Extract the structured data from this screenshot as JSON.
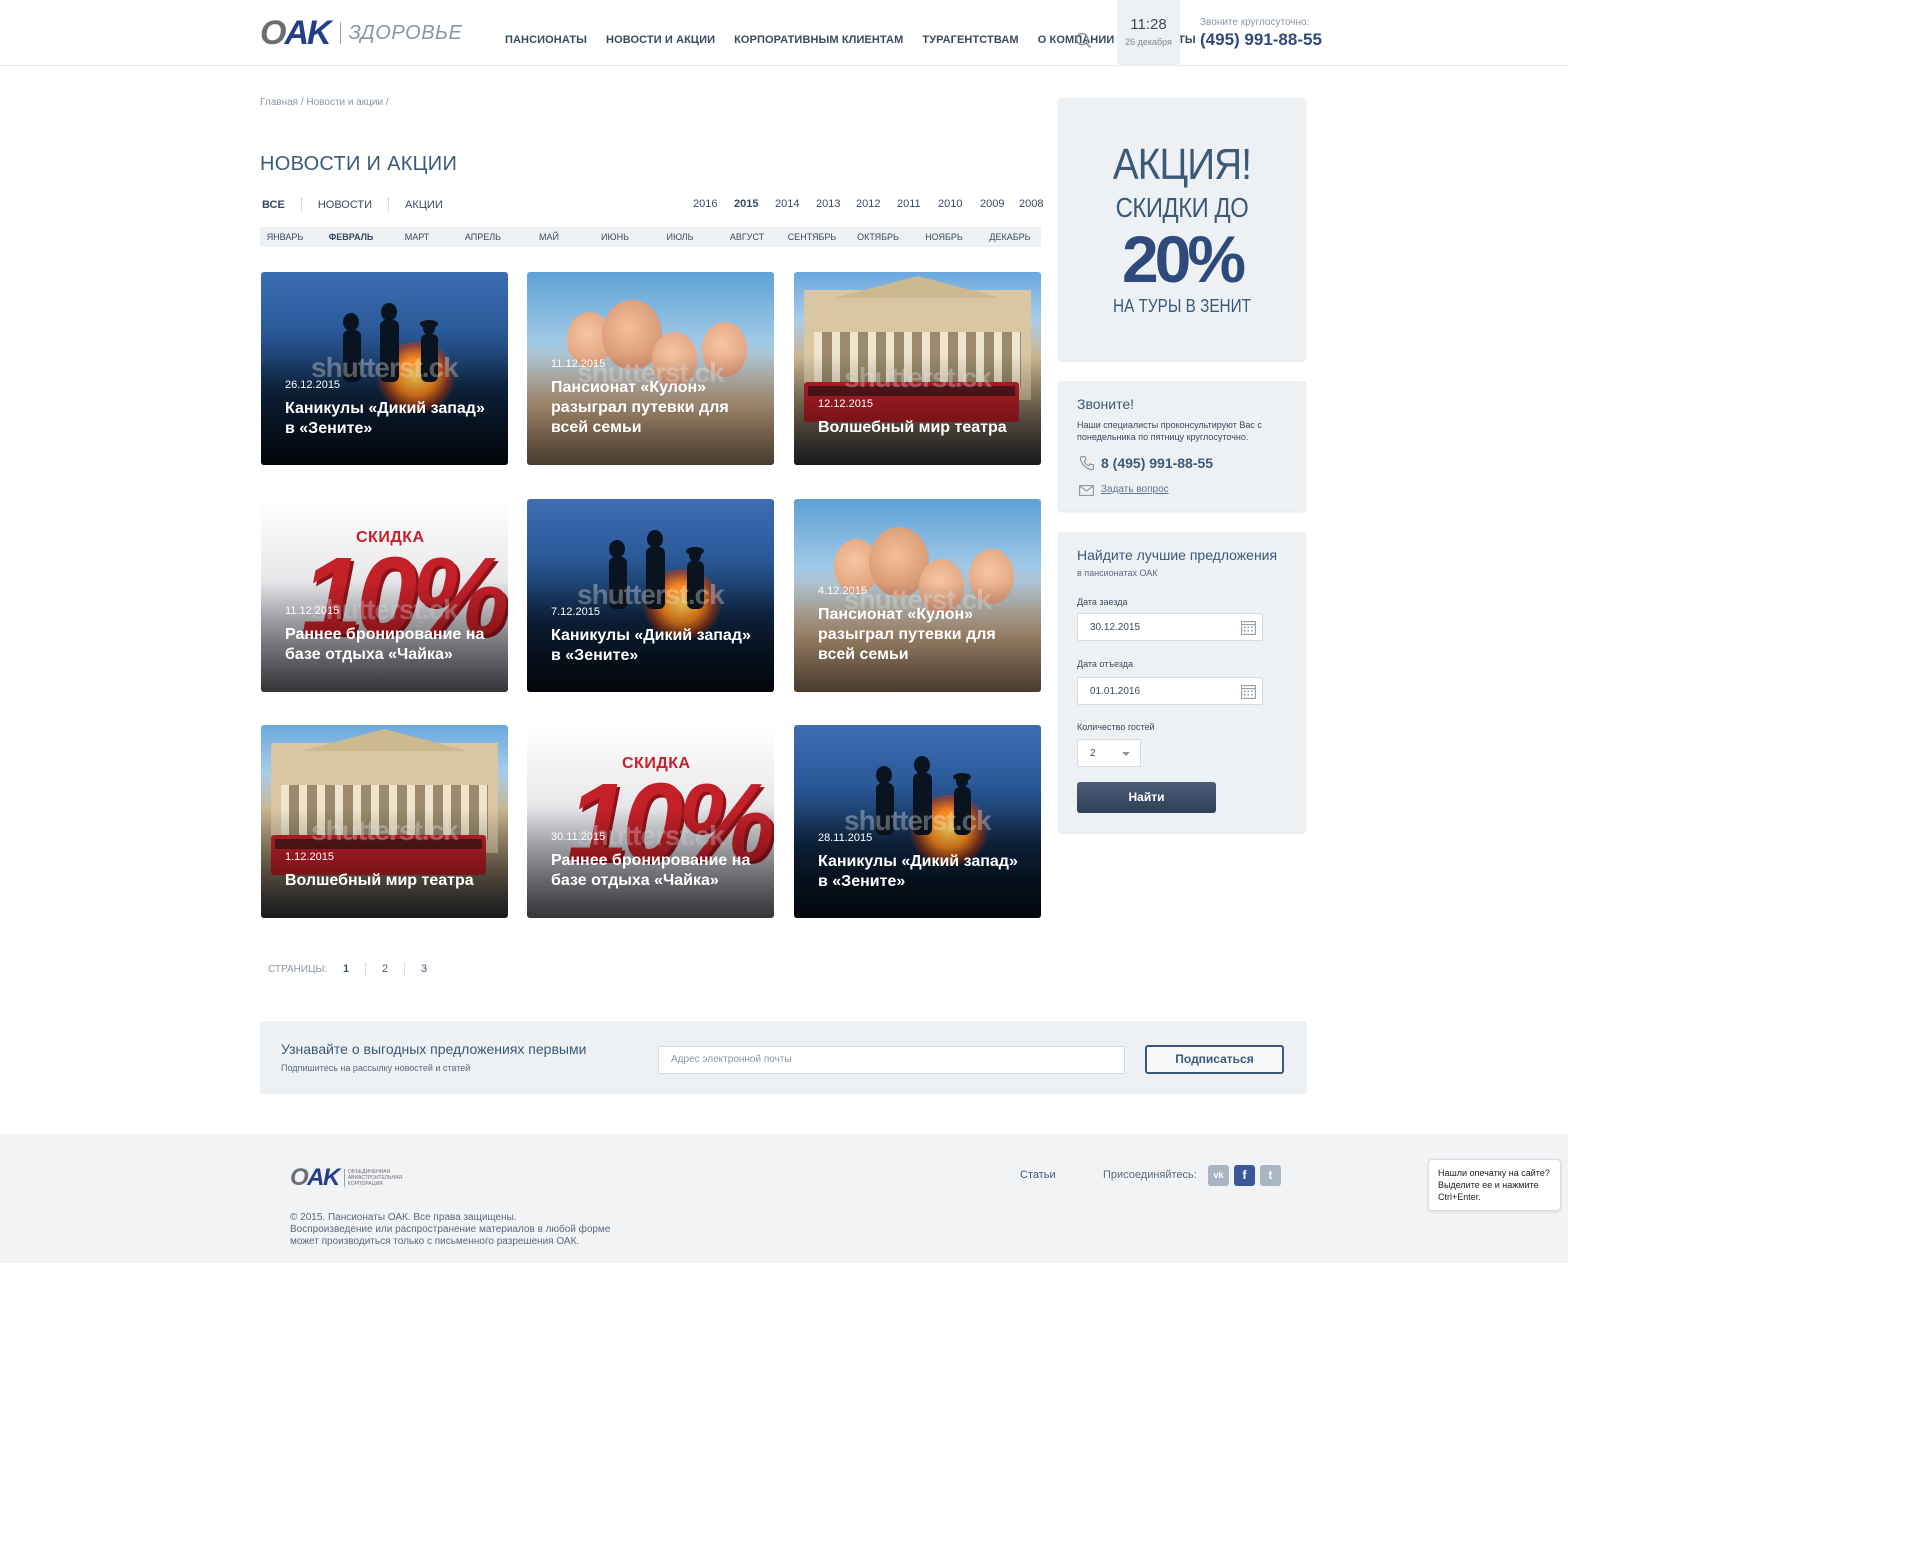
{
  "header": {
    "logo_mark_o": "O",
    "logo_mark_rest": "AK",
    "logo_sub": "ЗДОРОВЬЕ",
    "nav": [
      "ПАНСИОНАТЫ",
      "НОВОСТИ И АКЦИИ",
      "КОРПОРАТИВНЫМ КЛИЕНТАМ",
      "ТУРАГЕНТСТВАМ",
      "О КОМПАНИИ",
      "КОНТАКТЫ"
    ],
    "search_icon": "search-icon",
    "time": "11:28",
    "date": "26 декабря",
    "call_label": "Звоните круглосуточно:",
    "call_phone": "(495) 991-88-55"
  },
  "breadcrumb": "Главная / Новости и акции /",
  "page_title": "НОВОСТИ И АКЦИИ",
  "filters": {
    "types": [
      "ВСЕ",
      "НОВОСТИ",
      "АКЦИИ"
    ],
    "active_type": "ВСЕ",
    "years": [
      "2016",
      "2015",
      "2014",
      "2013",
      "2012",
      "2011",
      "2010",
      "2009",
      "2008"
    ],
    "active_year": "2015",
    "months": [
      "ЯНВАРЬ",
      "ФЕВРАЛЬ",
      "МАРТ",
      "АПРЕЛЬ",
      "МАЙ",
      "ИЮНЬ",
      "ИЮЛЬ",
      "АВГУСТ",
      "СЕНТЯБРЬ",
      "ОКТЯБРЬ",
      "НОЯБРЬ",
      "ДЕКАБРЬ"
    ],
    "active_month": "ФЕВРАЛЬ"
  },
  "cards": [
    {
      "date": "26.12.2015",
      "title": "Каникулы «Дикий запад» в «Зените»",
      "image": "fire"
    },
    {
      "date": "11.12.2015",
      "title": "Пансионат «Кулон» разыграл путевки для всей семьи",
      "image": "family"
    },
    {
      "date": "12.12.2015",
      "title": "Волшебный мир театра",
      "image": "theatre"
    },
    {
      "date": "11.12.2015",
      "title": "Раннее бронирование на базе отдыха «Чайка»",
      "image": "sale"
    },
    {
      "date": "7.12.2015",
      "title": "Каникулы «Дикий запад» в «Зените»",
      "image": "fire"
    },
    {
      "date": "4.12.2015",
      "title": "Пансионат «Кулон» разыграл путевки для всей семьи",
      "image": "family"
    },
    {
      "date": "1.12.2015",
      "title": "Волшебный мир театра",
      "image": "theatre"
    },
    {
      "date": "30.11.2015",
      "title": "Раннее бронирование на базе отдыха «Чайка»",
      "image": "sale"
    },
    {
      "date": "28.11.2015",
      "title": "Каникулы «Дикий запад» в «Зените»",
      "image": "fire"
    }
  ],
  "image_text": {
    "watermark": "shutterst.ck",
    "sale_word": "СКИДКА",
    "sale_big": "10%"
  },
  "pagination": {
    "label": "СТРАНИЦЫ:",
    "pages": [
      "1",
      "2",
      "3"
    ],
    "active": "1"
  },
  "subscribe": {
    "heading": "Узнавайте о выгодных предложениях первыми",
    "sub": "Подпишитесь на рассылку новостей и статей",
    "placeholder": "Адрес электронной почты",
    "button": "Подписаться"
  },
  "promo": {
    "line1": "АКЦИЯ!",
    "line2": "СКИДКИ ДО",
    "line3": "20%",
    "line4": "НА ТУРЫ В ЗЕНИТ"
  },
  "callbox": {
    "heading": "Звоните!",
    "text": "Наши специалисты проконсультируют Вас с понедельника по пятницу круглосуточно.",
    "phone": "8 (495) 991-88-55",
    "ask": "Задать вопрос"
  },
  "finder": {
    "heading": "Найдите лучшие предложения",
    "sub": "в пансионатах ОАК",
    "checkin_label": "Дата заезда",
    "checkin_value": "30.12.2015",
    "checkout_label": "Дата отъезда",
    "checkout_value": "01.01.2016",
    "guests_label": "Количество гостей",
    "guests_value": "2",
    "button": "Найти"
  },
  "footer": {
    "logo_o": "O",
    "logo_rest": "AK",
    "logo_text_1": "ОБЪЕДИНЕННАЯ",
    "logo_text_2": "АВИАСТРОИТЕЛЬНАЯ",
    "logo_text_3": "КОРПОРАЦИЯ",
    "copy_1": "© 2015. Пансионаты ОАК. Все права защищены.",
    "copy_2": "Воспроизведение или распространение материалов в любой форме",
    "copy_3": "может производиться только с письменного разрешения ОАК.",
    "articles": "Статьи",
    "join": "Присоединяйтесь:",
    "vk": "vk",
    "fb": "f",
    "tw": "t"
  },
  "typo_widget": {
    "line1": "Нашли опечатку на сайте?",
    "line2": "Выделите ее и нажмите",
    "line3": "Ctrl+Enter."
  }
}
